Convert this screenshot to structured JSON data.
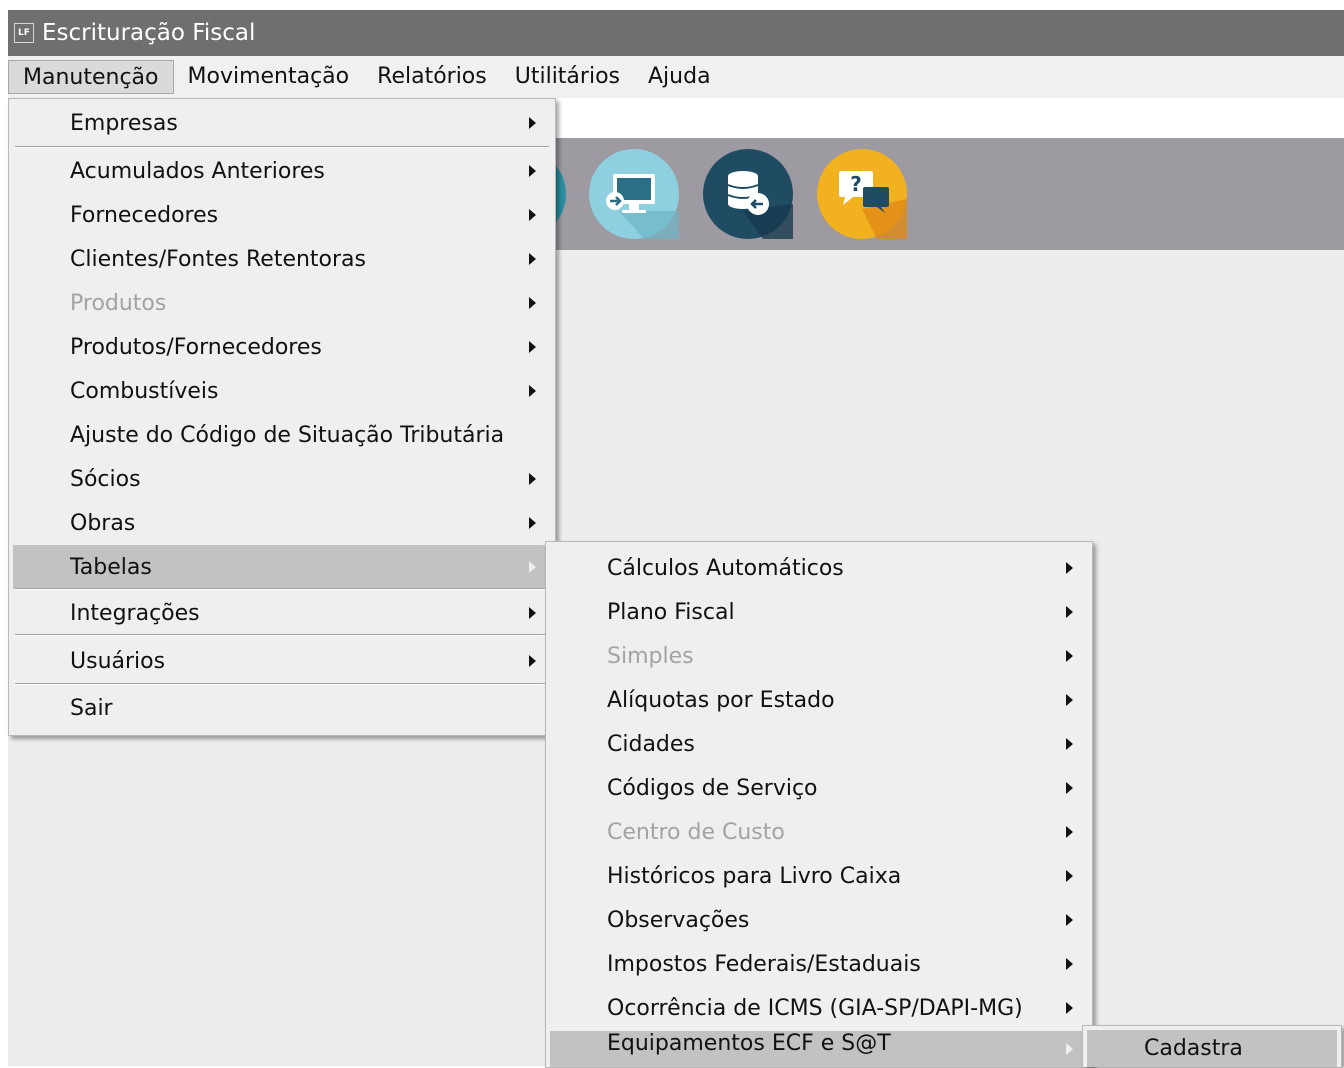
{
  "window": {
    "title": "Escrituração Fiscal",
    "app_icon_text": "LF"
  },
  "menubar": [
    {
      "label": "Manutenção",
      "active": true
    },
    {
      "label": "Movimentação"
    },
    {
      "label": "Relatórios"
    },
    {
      "label": "Utilitários"
    },
    {
      "label": "Ajuda"
    }
  ],
  "toolbar": {
    "buttons": [
      {
        "icon": "monitor-arrow-icon",
        "color": "#8ecfe0"
      },
      {
        "icon": "database-arrow-icon",
        "color": "#1f4b63"
      },
      {
        "icon": "help-chat-icon",
        "color": "#f2b11f"
      }
    ]
  },
  "menu_manutencao": {
    "items": [
      {
        "label": "Empresas",
        "submenu": true
      },
      {
        "label": "Acumulados Anteriores",
        "submenu": true
      },
      {
        "label": "Fornecedores",
        "submenu": true
      },
      {
        "label": "Clientes/Fontes Retentoras",
        "submenu": true
      },
      {
        "label": "Produtos",
        "submenu": true,
        "disabled": true
      },
      {
        "label": "Produtos/Fornecedores",
        "submenu": true
      },
      {
        "label": "Combustíveis",
        "submenu": true
      },
      {
        "label": "Ajuste do Código de Situação Tributária",
        "submenu": false
      },
      {
        "label": "Sócios",
        "submenu": true
      },
      {
        "label": "Obras",
        "submenu": true
      },
      {
        "label": "Tabelas",
        "submenu": true,
        "highlighted": true
      },
      {
        "label": "Integrações",
        "submenu": true
      },
      {
        "label": "Usuários",
        "submenu": true
      },
      {
        "label": "Sair",
        "submenu": false
      }
    ]
  },
  "menu_tabelas": {
    "items": [
      {
        "label": "Cálculos Automáticos",
        "submenu": true
      },
      {
        "label": "Plano Fiscal",
        "submenu": true
      },
      {
        "label": "Simples",
        "submenu": true,
        "disabled": true
      },
      {
        "label": "Alíquotas por Estado",
        "submenu": true
      },
      {
        "label": "Cidades",
        "submenu": true
      },
      {
        "label": "Códigos de Serviço",
        "submenu": true
      },
      {
        "label": "Centro de Custo",
        "submenu": true,
        "disabled": true
      },
      {
        "label": "Históricos para Livro Caixa",
        "submenu": true
      },
      {
        "label": "Observações",
        "submenu": true
      },
      {
        "label": "Impostos Federais/Estaduais",
        "submenu": true
      },
      {
        "label": "Ocorrência de ICMS (GIA-SP/DAPI-MG)",
        "submenu": true
      },
      {
        "label": "Equipamentos ECF e S@T",
        "submenu": true,
        "highlighted": true
      }
    ]
  },
  "menu_equipamentos": {
    "items": [
      {
        "label": "Cadastra",
        "highlighted": true
      }
    ]
  }
}
